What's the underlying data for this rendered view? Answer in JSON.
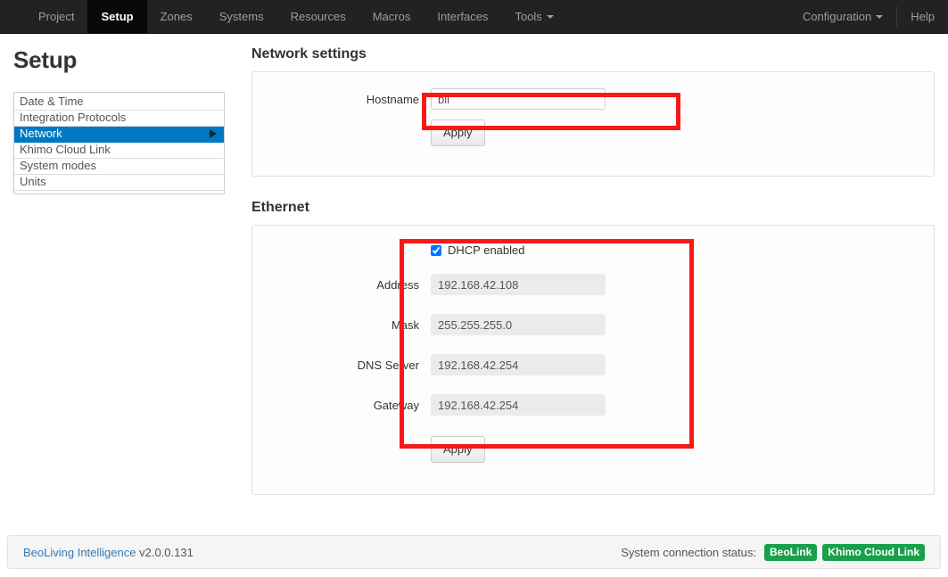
{
  "navbar": {
    "left_items": [
      {
        "label": "Project",
        "active": false,
        "caret": false
      },
      {
        "label": "Setup",
        "active": true,
        "caret": false
      },
      {
        "label": "Zones",
        "active": false,
        "caret": false
      },
      {
        "label": "Systems",
        "active": false,
        "caret": false
      },
      {
        "label": "Resources",
        "active": false,
        "caret": false
      },
      {
        "label": "Macros",
        "active": false,
        "caret": false
      },
      {
        "label": "Interfaces",
        "active": false,
        "caret": false
      },
      {
        "label": "Tools",
        "active": false,
        "caret": true
      }
    ],
    "right_items": [
      {
        "label": "Configuration",
        "caret": true
      },
      {
        "label": "Help",
        "caret": false
      }
    ]
  },
  "sidebar": {
    "title": "Setup",
    "items": [
      {
        "label": "Date & Time",
        "active": false
      },
      {
        "label": "Integration Protocols",
        "active": false
      },
      {
        "label": "Network",
        "active": true
      },
      {
        "label": "Khimo Cloud Link",
        "active": false
      },
      {
        "label": "System modes",
        "active": false
      },
      {
        "label": "Units",
        "active": false
      }
    ]
  },
  "network_settings": {
    "heading": "Network settings",
    "hostname_label": "Hostname",
    "hostname_value": "bli",
    "hostname_placeholder": "",
    "apply_label": "Apply"
  },
  "ethernet": {
    "heading": "Ethernet",
    "dhcp_label": "DHCP enabled",
    "dhcp_checked": true,
    "fields": [
      {
        "label": "Address",
        "value": "192.168.42.108",
        "disabled": true
      },
      {
        "label": "Mask",
        "value": "255.255.255.0",
        "disabled": true
      },
      {
        "label": "DNS Server",
        "value": "192.168.42.254",
        "disabled": true
      },
      {
        "label": "Gateway",
        "value": "192.168.42.254",
        "disabled": true
      }
    ],
    "apply_label": "Apply"
  },
  "annotations": {
    "hostname_box_color": "#f81818",
    "ethernet_box_color": "#f81818"
  },
  "footer": {
    "product_link": "BeoLiving Intelligence",
    "version": "v2.0.0.131",
    "status_label": "System connection status:",
    "badges": [
      {
        "label": "BeoLink",
        "color": "#18a04a"
      },
      {
        "label": "Khimo Cloud Link",
        "color": "#18a04a"
      }
    ]
  }
}
